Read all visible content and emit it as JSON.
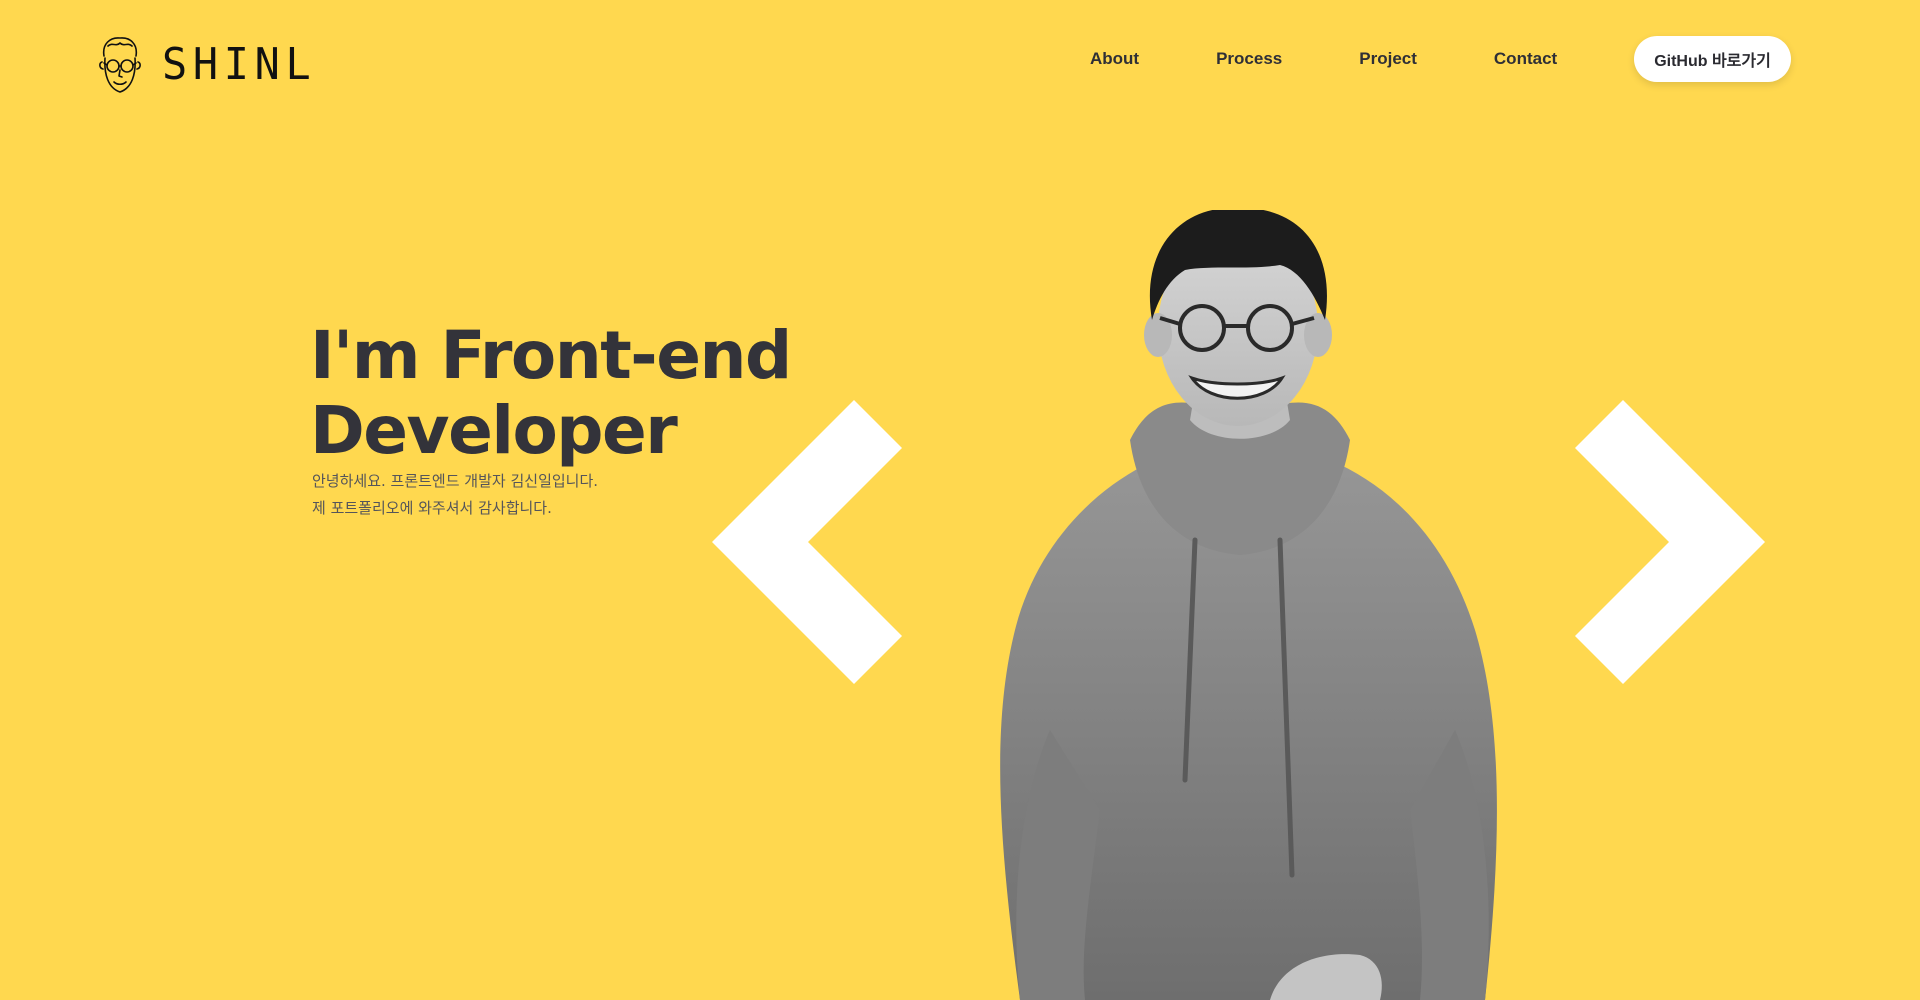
{
  "header": {
    "logo_text": "SHINL",
    "nav": [
      {
        "label": "About"
      },
      {
        "label": "Process"
      },
      {
        "label": "Project"
      },
      {
        "label": "Contact"
      }
    ],
    "github_button": "GitHub 바로가기"
  },
  "hero": {
    "title_line1": "I'm Front-end",
    "title_line2": "Developer",
    "subtitle_line1": "안녕하세요. 프론트엔드 개발자 김신일입니다.",
    "subtitle_line2": "제 포트폴리오에 와주셔서 감사합니다."
  },
  "colors": {
    "background": "#FFD84F",
    "text_dark": "#33333a",
    "chevron": "#FFFFFF"
  },
  "icons": {
    "logo": "face-with-glasses-icon",
    "left": "chevron-left-icon",
    "right": "chevron-right-icon"
  }
}
